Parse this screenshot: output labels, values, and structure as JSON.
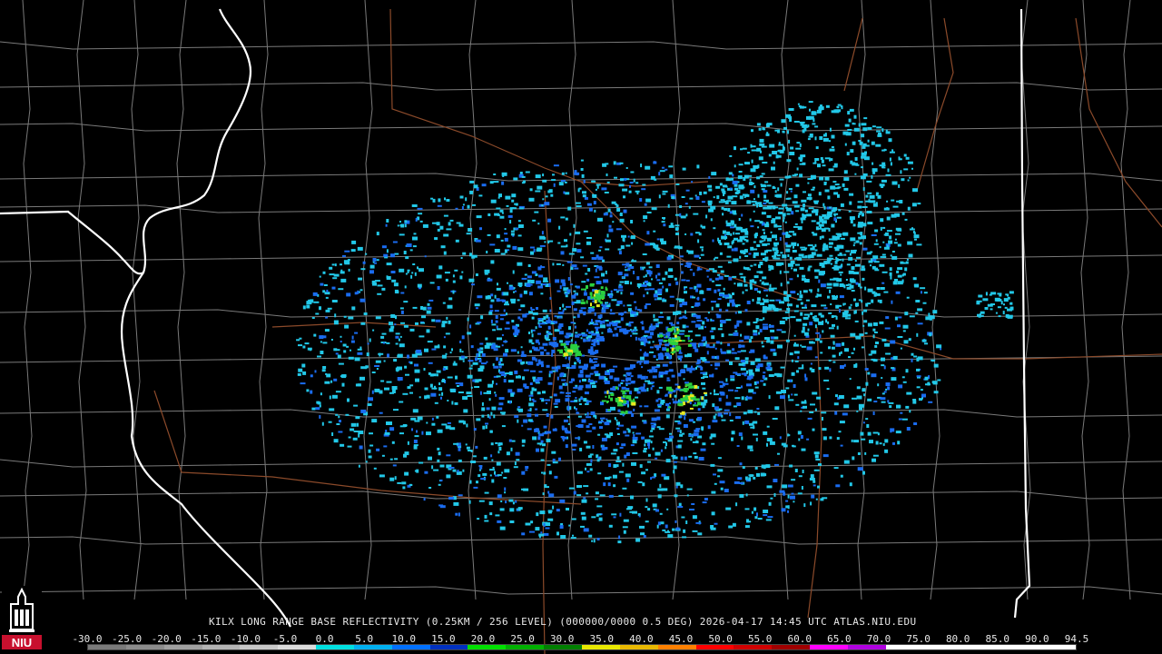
{
  "caption": "KILX LONG RANGE BASE REFLECTIVITY (0.25KM / 256 LEVEL) (000000/0000 0.5 DEG) 2026-04-17 14:45 UTC  ATLAS.NIU.EDU",
  "colorbar": {
    "ticks": [
      "-30.0",
      "-25.0",
      "-20.0",
      "-15.0",
      "-10.0",
      "-5.0",
      "0.0",
      "5.0",
      "10.0",
      "15.0",
      "20.0",
      "25.0",
      "30.0",
      "35.0",
      "40.0",
      "45.0",
      "50.0",
      "55.0",
      "60.0",
      "65.0",
      "70.0",
      "75.0",
      "80.0",
      "85.0",
      "90.0",
      "94.5"
    ],
    "colors": [
      "#7a7a7a",
      "#8c8c8c",
      "#a0a0a0",
      "#b4b4b4",
      "#c8c8c8",
      "#dcdcdc",
      "#00e0e0",
      "#00b0f0",
      "#0070ff",
      "#0030c0",
      "#00e000",
      "#00b000",
      "#008000",
      "#e8e800",
      "#e8b800",
      "#ff8000",
      "#ff0000",
      "#d00000",
      "#a00000",
      "#ff00ff",
      "#b000e0",
      "#ffffff",
      "#ffffff",
      "#ffffff",
      "#ffffff",
      "#ffffff"
    ]
  },
  "logo": {
    "text": "NIU",
    "color": "#c8102e"
  },
  "colors": {
    "county_border": "#7a7a7a",
    "state_border": "#ffffff",
    "highway": "#8b4a2a",
    "radar_cyan": "#22c8e8",
    "radar_blue": "#1a6cf0",
    "radar_green": "#2ad040",
    "radar_yellow": "#e8e820"
  },
  "radar": {
    "site": "KILX"
  }
}
